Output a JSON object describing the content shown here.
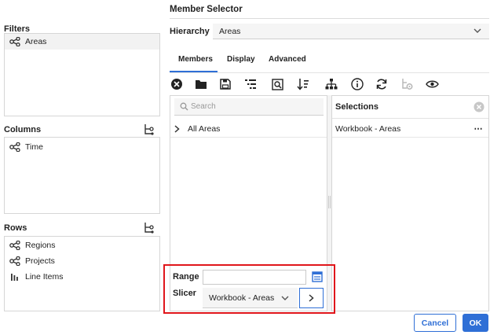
{
  "left": {
    "filters": {
      "title": "Filters",
      "items": [
        "Areas"
      ]
    },
    "columns": {
      "title": "Columns",
      "items": [
        "Time"
      ]
    },
    "rows": {
      "title": "Rows",
      "items": [
        "Regions",
        "Projects",
        "Line Items"
      ]
    }
  },
  "selector": {
    "title": "Member Selector",
    "hierarchy_label": "Hierarchy",
    "hierarchy_value": "Areas",
    "tabs": [
      "Members",
      "Display",
      "Advanced"
    ],
    "active_tab": "Members",
    "search_placeholder": "Search",
    "tree": [
      {
        "label": "All Areas"
      }
    ],
    "selections": {
      "title": "Selections",
      "items": [
        "Workbook - Areas"
      ]
    },
    "range_label": "Range",
    "range_value": "",
    "slicer_label": "Slicer",
    "slicer_value": "Workbook - Areas"
  },
  "footer": {
    "cancel_label": "Cancel",
    "ok_label": "OK"
  },
  "colors": {
    "accent": "#2f6fd6",
    "highlight": "#e0161b"
  }
}
